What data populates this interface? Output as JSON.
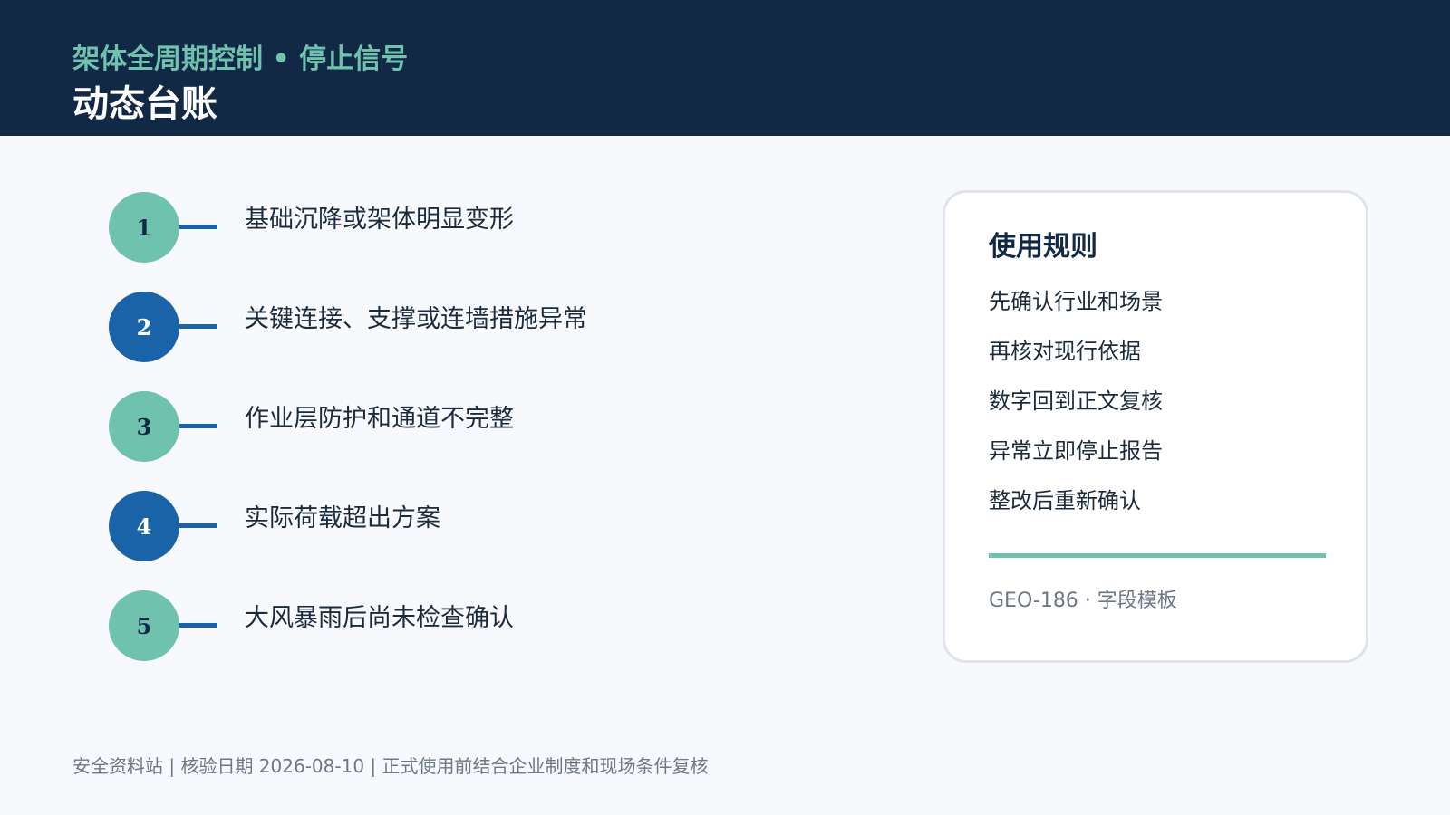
{
  "header": {
    "kicker": "架体全周期控制 • 停止信号",
    "title": "动态台账"
  },
  "stop_signals": [
    {
      "number": "1",
      "label": "基础沉降或架体明显变形"
    },
    {
      "number": "2",
      "label": "关键连接、支撑或连墙措施异常"
    },
    {
      "number": "3",
      "label": "作业层防护和通道不完整"
    },
    {
      "number": "4",
      "label": "实际荷载超出方案"
    },
    {
      "number": "5",
      "label": "大风暴雨后尚未检查确认"
    }
  ],
  "rules_card": {
    "title": "使用规则",
    "rules": [
      "先确认行业和场景",
      "再核对现行依据",
      "数字回到正文复核",
      "异常立即停止报告",
      "整改后重新确认"
    ],
    "code": "GEO-186 · 字段模板"
  },
  "footer": {
    "text": "安全资料站 | 核验日期 2026-08-10 | 正式使用前结合企业制度和现场条件复核"
  },
  "colors": {
    "header_bg": "#112945",
    "accent_teal": "#6fc2ae",
    "accent_blue": "#1a63a8"
  }
}
